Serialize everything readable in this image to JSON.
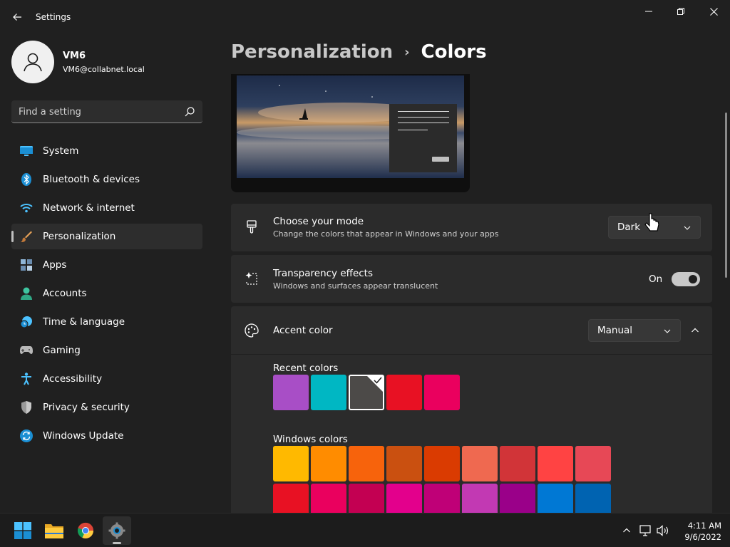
{
  "window": {
    "app_title": "Settings"
  },
  "user": {
    "name": "VM6",
    "email": "VM6@collabnet.local"
  },
  "search": {
    "placeholder": "Find a setting"
  },
  "nav": {
    "items": [
      {
        "label": "System",
        "icon": "system-icon"
      },
      {
        "label": "Bluetooth & devices",
        "icon": "bluetooth-icon"
      },
      {
        "label": "Network & internet",
        "icon": "wifi-icon"
      },
      {
        "label": "Personalization",
        "icon": "brush-icon",
        "active": true
      },
      {
        "label": "Apps",
        "icon": "apps-icon"
      },
      {
        "label": "Accounts",
        "icon": "accounts-icon"
      },
      {
        "label": "Time & language",
        "icon": "clock-globe-icon"
      },
      {
        "label": "Gaming",
        "icon": "gamepad-icon"
      },
      {
        "label": "Accessibility",
        "icon": "accessibility-icon"
      },
      {
        "label": "Privacy & security",
        "icon": "shield-icon"
      },
      {
        "label": "Windows Update",
        "icon": "update-icon"
      }
    ]
  },
  "breadcrumb": {
    "parent": "Personalization",
    "separator": "›",
    "current": "Colors"
  },
  "mode": {
    "title": "Choose your mode",
    "subtitle": "Change the colors that appear in Windows and your apps",
    "value": "Dark"
  },
  "transparency": {
    "title": "Transparency effects",
    "subtitle": "Windows and surfaces appear translucent",
    "state_label": "On",
    "enabled": true
  },
  "accent": {
    "title": "Accent color",
    "value": "Manual",
    "recent_label": "Recent colors",
    "recent_colors": [
      "#a84ec6",
      "#00b7c3",
      "#4c4a48",
      "#e81123",
      "#ea005e"
    ],
    "selected_recent_index": 2,
    "windows_label": "Windows colors",
    "windows_colors_row1": [
      "#ffb900",
      "#ff8c00",
      "#f7630c",
      "#ca5010",
      "#da3b01",
      "#ef6950",
      "#d13438",
      "#ff4343",
      "#e74856"
    ],
    "windows_colors_row2": [
      "#e81123",
      "#ea005e",
      "#c30052",
      "#e3008c",
      "#bf0077",
      "#c239b3",
      "#9a0089",
      "#0078d4",
      "#0063b1"
    ]
  },
  "taskbar": {
    "time": "4:11 AM",
    "date": "9/6/2022"
  }
}
